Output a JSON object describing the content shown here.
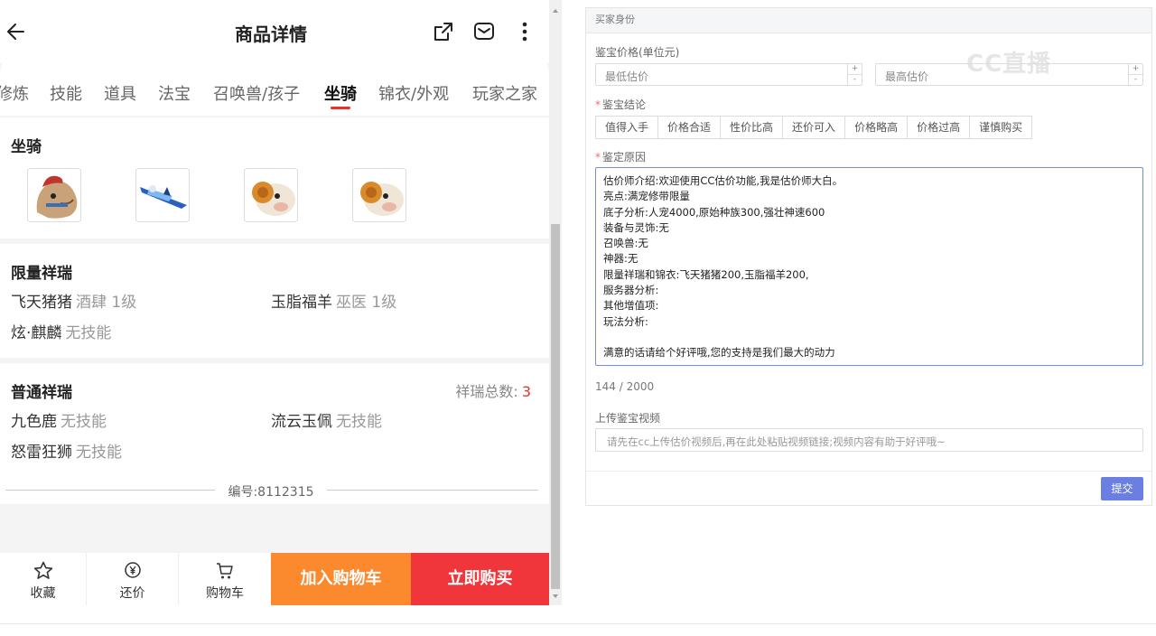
{
  "header": {
    "title": "商品详情"
  },
  "tabs": [
    {
      "label": "修炼"
    },
    {
      "label": "技能"
    },
    {
      "label": "道具"
    },
    {
      "label": "法宝"
    },
    {
      "label": "召唤兽/孩子"
    },
    {
      "label": "坐骑",
      "active": true
    },
    {
      "label": "锦衣/外观"
    },
    {
      "label": "玩家之家"
    }
  ],
  "mounts": {
    "title": "坐骑",
    "items": [
      {
        "icon": "horse-mount-icon"
      },
      {
        "icon": "flying-vehicle-mount-icon"
      },
      {
        "icon": "sheep-mount-icon"
      },
      {
        "icon": "sheep-mount-icon"
      }
    ]
  },
  "limited": {
    "title": "限量祥瑞",
    "items": [
      {
        "name": "飞天猪猪",
        "desc": "酒肆 1级"
      },
      {
        "name": "玉脂福羊",
        "desc": "巫医 1级"
      },
      {
        "name": "炫·麒麟",
        "desc": "无技能"
      }
    ]
  },
  "normal": {
    "title": "普通祥瑞",
    "total_label": "祥瑞总数:",
    "total_value": "3",
    "items": [
      {
        "name": "九色鹿",
        "desc": "无技能"
      },
      {
        "name": "流云玉佩",
        "desc": "无技能"
      },
      {
        "name": "怒雷狂狮",
        "desc": "无技能"
      }
    ]
  },
  "product_code": "编号:8112315",
  "bottom_bar": {
    "favorite": "收藏",
    "bargain": "还价",
    "cart": "购物车",
    "add_to_cart": "加入购物车",
    "buy_now": "立即购买"
  },
  "form": {
    "header": "买家身份",
    "price_label": "鉴宝价格(单位元)",
    "min_price_placeholder": "最低估价",
    "max_price_placeholder": "最高估价",
    "conclusion_label": "鉴宝结论",
    "conclusions": [
      "值得入手",
      "价格合适",
      "性价比高",
      "还价可入",
      "价格略高",
      "价格过高",
      "谨慎购买"
    ],
    "reason_label": "鉴定原因",
    "reason_lines": [
      "估价师介绍:欢迎使用CC估价功能,我是估价师大白。",
      "亮点:满宠修带限量",
      "底子分析:人宠4000,原始种族300,强壮神速600",
      "装备与灵饰:无",
      "召唤兽:无",
      "神器:无",
      "限量祥瑞和锦衣:飞天猪猪200,玉脂福羊200,",
      "服务器分析:",
      "其他增值项:",
      "玩法分析:",
      "",
      "满意的话请给个好评哦,您的支持是我们最大的动力"
    ],
    "char_count": "144 / 2000",
    "video_label": "上传鉴宝视频",
    "video_placeholder": "请先在cc上传估价视频后,再在此处粘贴视频链接;视频内容有助于好评哦~",
    "submit": "提交"
  },
  "watermark": "CC直播",
  "colors": {
    "accent_red": "#e8322b",
    "cart_orange": "#fb8a2e",
    "buy_red": "#f1363b",
    "submit_blue": "#6b7fe3"
  }
}
